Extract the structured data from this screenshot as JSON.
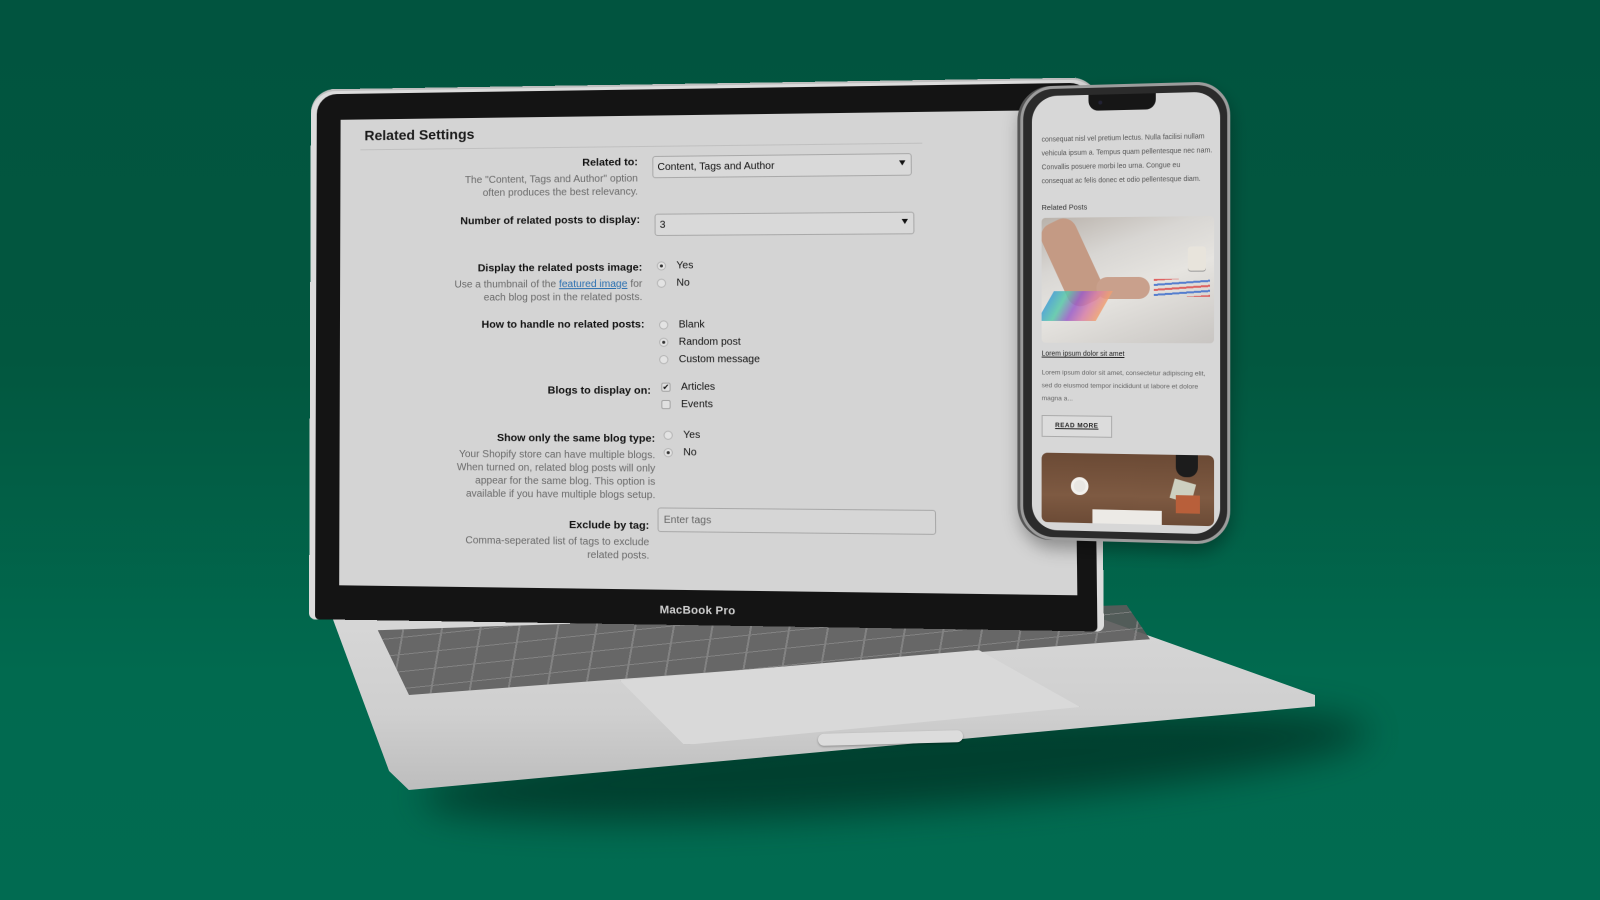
{
  "laptop": {
    "brand_label": "MacBook Pro"
  },
  "settings": {
    "title": "Related Settings",
    "related_to": {
      "label": "Related to:",
      "help": "The \"Content, Tags and Author\" option often produces the best relevancy.",
      "value": "Content, Tags and Author"
    },
    "num_posts": {
      "label": "Number of related posts to display:",
      "value": "3"
    },
    "display_image": {
      "label": "Display the related posts image:",
      "help_prefix": "Use a thumbnail of the ",
      "help_link": "featured image",
      "help_suffix": " for each blog post in the related posts.",
      "options": [
        {
          "label": "Yes",
          "selected": true
        },
        {
          "label": "No",
          "selected": false
        }
      ]
    },
    "no_related": {
      "label": "How to handle no related posts:",
      "options": [
        {
          "label": "Blank",
          "selected": false
        },
        {
          "label": "Random post",
          "selected": true
        },
        {
          "label": "Custom message",
          "selected": false
        }
      ]
    },
    "blogs": {
      "label": "Blogs to display on:",
      "options": [
        {
          "label": "Articles",
          "checked": true
        },
        {
          "label": "Events",
          "checked": false
        }
      ]
    },
    "same_type": {
      "label": "Show only the same blog type:",
      "help": "Your Shopify store can have multiple blogs. When turned on, related blog posts will only appear for the same blog. This option is available if you have multiple blogs setup.",
      "options": [
        {
          "label": "Yes",
          "selected": false
        },
        {
          "label": "No",
          "selected": true
        }
      ]
    },
    "exclude_tag": {
      "label": "Exclude by tag:",
      "help": "Comma-seperated list of tags to exclude related posts.",
      "placeholder": "Enter tags",
      "value": ""
    }
  },
  "phone": {
    "body_text": "consequat nisl vel pretium lectus. Nulla facilisi nullam vehicula ipsum a. Tempus quam pellentesque nec nam. Convallis posuere morbi leo urna. Congue eu consequat ac felis donec et odio pellentesque diam.",
    "related_heading": "Related Posts",
    "post": {
      "title": "Lorem ipsum dolor sit amet",
      "excerpt": "Lorem ipsum dolor sit amet, consectetur adipiscing elit, sed do eiusmod tempor incididunt ut labore et dolore magna a...",
      "button": "READ MORE"
    }
  },
  "colors": {
    "background": "#02573f",
    "link": "#2a6fb0"
  }
}
